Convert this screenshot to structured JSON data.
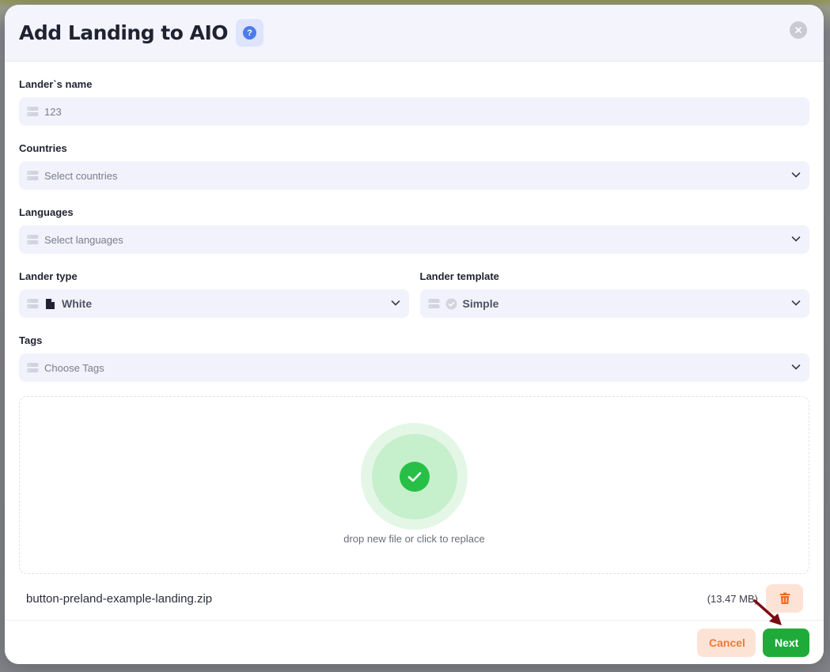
{
  "modal": {
    "title": "Add Landing to AIO",
    "help_label": "?"
  },
  "form": {
    "name": {
      "label": "Lander`s name",
      "value": "123"
    },
    "countries": {
      "label": "Countries",
      "placeholder": "Select countries"
    },
    "languages": {
      "label": "Languages",
      "placeholder": "Select languages"
    },
    "lander_type": {
      "label": "Lander type",
      "value": "White"
    },
    "lander_template": {
      "label": "Lander template",
      "value": "Simple"
    },
    "tags": {
      "label": "Tags",
      "placeholder": "Choose Tags"
    }
  },
  "upload": {
    "hint": "drop new file or click to replace",
    "file_name": "button-preland-example-landing.zip",
    "file_size": "(13.47 MB)"
  },
  "footer": {
    "cancel_label": "Cancel",
    "next_label": "Next"
  },
  "colors": {
    "accent_green": "#1fab3a",
    "cancel_orange": "#f07a3a",
    "help_blue": "#4f7bea"
  }
}
